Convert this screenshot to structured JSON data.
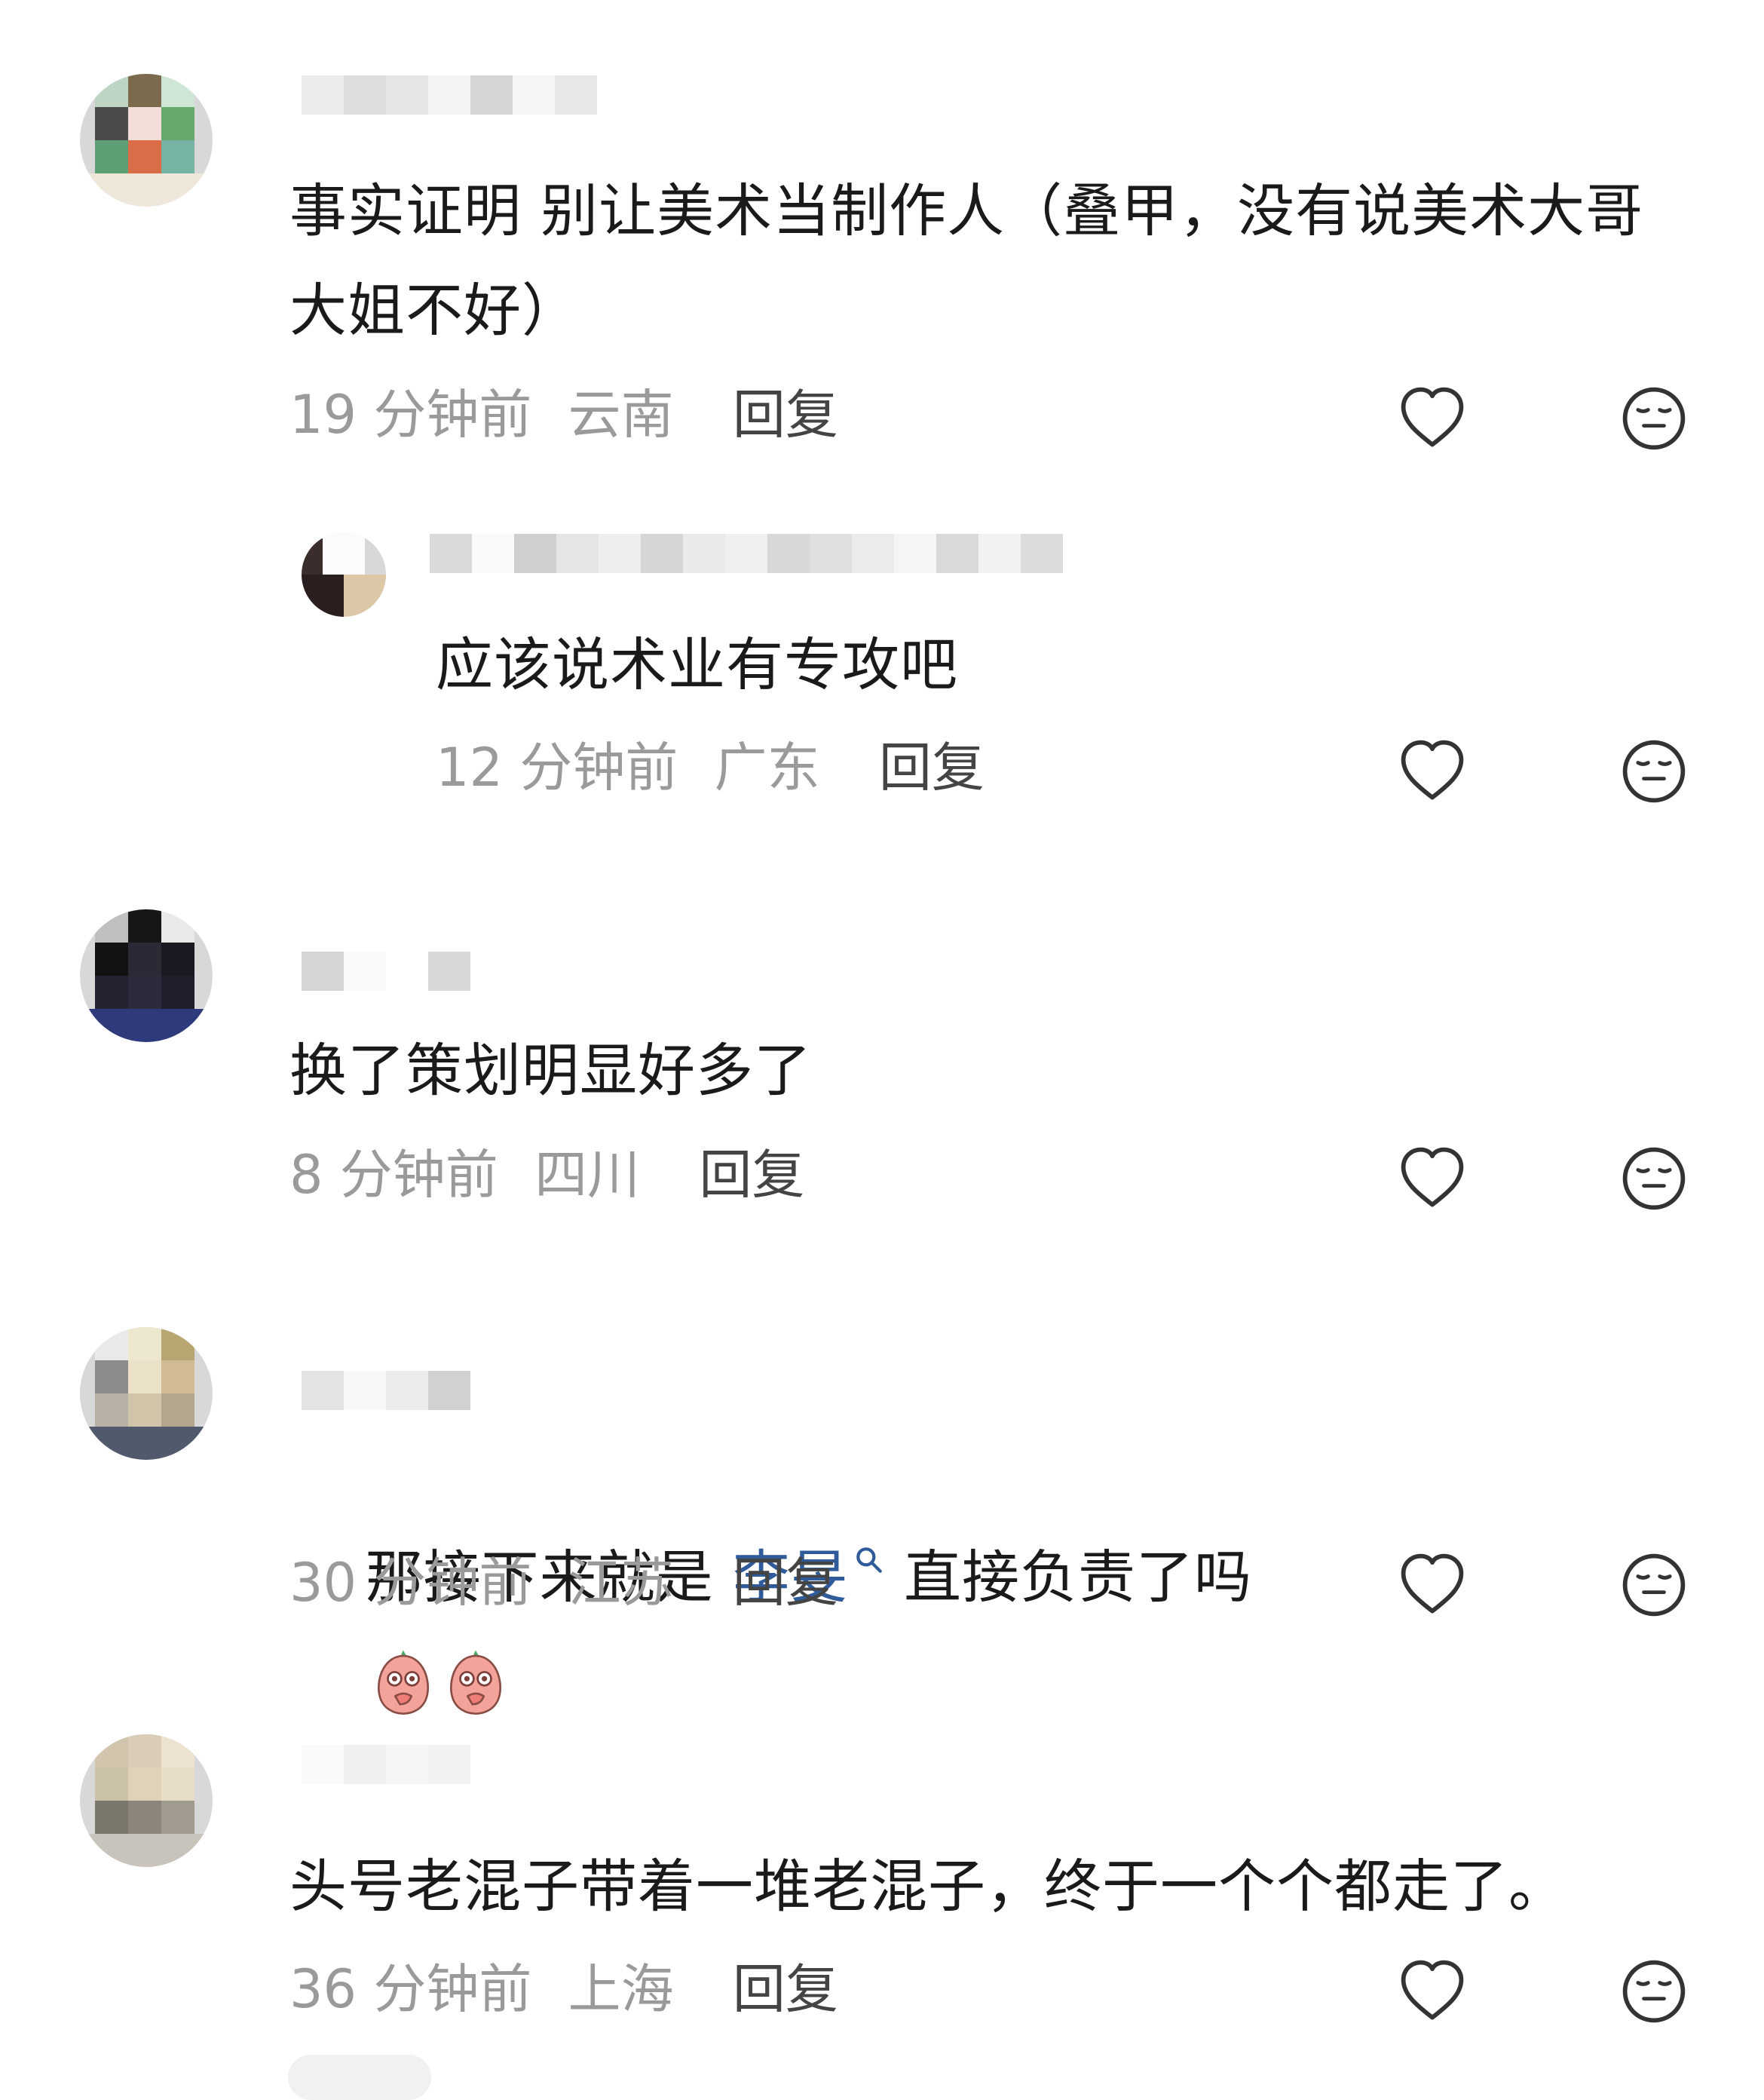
{
  "comments": [
    {
      "text": "事实证明 别让美术当制作人（叠甲，没有说美术大哥大姐不好）",
      "time": "19 分钟前",
      "region": "云南",
      "reply": "回复"
    },
    {
      "text": "应该说术业有专攻吧",
      "time": "12 分钟前",
      "region": "广东",
      "reply": "回复"
    },
    {
      "text": "换了策划明显好多了",
      "time": "8 分钟前",
      "region": "四川",
      "reply": "回复"
    },
    {
      "text_before": "那接下来就是 ",
      "mention": "李旻",
      "mention_icon": "search-icon",
      "text_after": " 直接负责了吗",
      "time": "30 分钟前",
      "region": "江苏",
      "reply": "回复"
    },
    {
      "text": "头号老混子带着一堆老混子，终于一个个都走了。",
      "time": "36 分钟前",
      "region": "上海",
      "reply": "回复"
    }
  ],
  "icons": {
    "like": "heart-icon",
    "dislike": "neutral-face-icon",
    "emoji": "peach-face-icon"
  },
  "colors": {
    "text": "#1a1a1a",
    "meta": "#9a9a9a",
    "mention": "#2f5b9a"
  }
}
